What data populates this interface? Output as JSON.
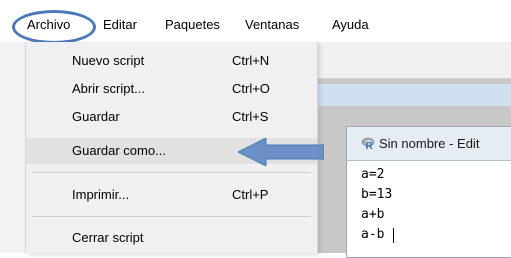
{
  "menubar": {
    "items": [
      {
        "label": "Archivo"
      },
      {
        "label": "Editar"
      },
      {
        "label": "Paquetes"
      },
      {
        "label": "Ventanas"
      },
      {
        "label": "Ayuda"
      }
    ]
  },
  "file_menu": {
    "items": [
      {
        "label": "Nuevo script",
        "shortcut": "Ctrl+N"
      },
      {
        "label": "Abrir script...",
        "shortcut": "Ctrl+O"
      },
      {
        "label": "Guardar",
        "shortcut": "Ctrl+S"
      },
      {
        "label": "Guardar como...",
        "shortcut": ""
      },
      {
        "label": "Imprimir...",
        "shortcut": "Ctrl+P"
      },
      {
        "label": "Cerrar script",
        "shortcut": ""
      }
    ]
  },
  "editor": {
    "title": "Sin nombre - Edit",
    "lines": [
      "a=2",
      "b=13",
      "a+b",
      "a-b"
    ]
  },
  "colors": {
    "annotation": "#4a78b8",
    "menu_bg": "#f0f0f0",
    "hover_bg": "#e1e1e1"
  }
}
